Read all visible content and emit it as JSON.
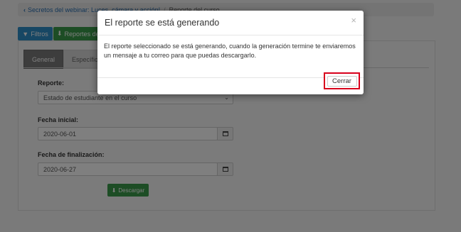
{
  "breadcrumb": {
    "back_link": "Secretos del webinar: Luces, cámara y acción!",
    "current": "Reporte del curso"
  },
  "toolbar": {
    "filtros_label": "Filtros",
    "reportes_label": "Reportes de"
  },
  "tabs": [
    {
      "label": "General",
      "active": true
    },
    {
      "label": "Específico",
      "active": false
    }
  ],
  "form": {
    "reporte_label": "Reporte:",
    "reporte_value": "Estado de estudiante en el curso",
    "fecha_inicial_label": "Fecha inicial:",
    "fecha_inicial_value": "2020-06-01",
    "fecha_final_label": "Fecha de finalización:",
    "fecha_final_value": "2020-06-27",
    "descargar_label": "Descargar"
  },
  "modal": {
    "title": "El reporte se está generando",
    "close_glyph": "×",
    "body": "El reporte seleccionado se está generando, cuando la generación termine te enviaremos un mensaje a tu correo para que puedas descargarlo.",
    "cerrar_label": "Cerrar"
  },
  "colors": {
    "highlight_border": "#d8001c",
    "primary_blue": "#2f8fc9",
    "success_green": "#3a9a4a"
  }
}
